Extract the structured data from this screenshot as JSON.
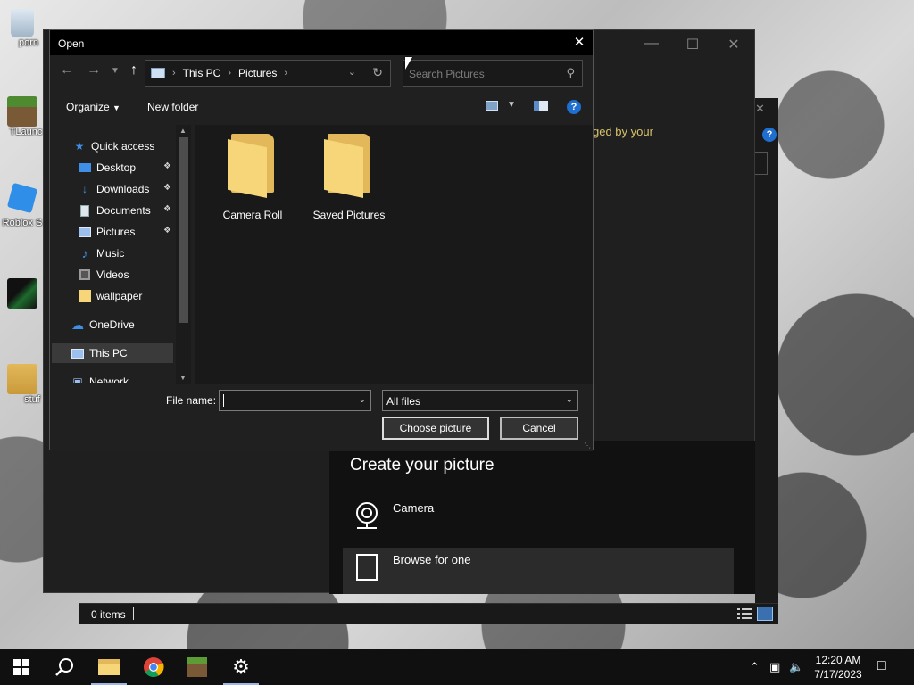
{
  "desktop": {
    "icons": [
      {
        "name": "recycle-bin-icon",
        "label": "porn"
      },
      {
        "name": "tlauncher-icon",
        "label": "TLaunc"
      },
      {
        "name": "roblox-icon",
        "label": "Roblox S"
      },
      {
        "name": "shortcut-icon",
        "label": ""
      },
      {
        "name": "folder-stuff-icon",
        "label": "stuf"
      }
    ]
  },
  "settings_window": {
    "notice": "ged by your",
    "panel_title": "Create your picture",
    "options": [
      {
        "label": "Camera"
      },
      {
        "label": "Browse for one"
      }
    ]
  },
  "explorer_status": {
    "items_count": "0 items"
  },
  "dialog": {
    "title": "Open",
    "close_glyph": "✕",
    "breadcrumb": [
      "This PC",
      "Pictures"
    ],
    "search_placeholder": "Search Pictures",
    "toolbar": {
      "organize": "Organize",
      "new_folder": "New folder",
      "help": "?"
    },
    "nav": [
      {
        "label": "Quick access",
        "icon": "star-icon",
        "pinned": false
      },
      {
        "label": "Desktop",
        "icon": "desktop-icon",
        "pinned": true
      },
      {
        "label": "Downloads",
        "icon": "download-icon",
        "pinned": true
      },
      {
        "label": "Documents",
        "icon": "documents-icon",
        "pinned": true
      },
      {
        "label": "Pictures",
        "icon": "pictures-icon",
        "pinned": true
      },
      {
        "label": "Music",
        "icon": "music-icon",
        "pinned": false
      },
      {
        "label": "Videos",
        "icon": "videos-icon",
        "pinned": false
      },
      {
        "label": "wallpaper",
        "icon": "folder-icon",
        "pinned": false
      },
      {
        "label": "OneDrive",
        "icon": "cloud-icon",
        "pinned": false
      },
      {
        "label": "This PC",
        "icon": "computer-icon",
        "pinned": false
      },
      {
        "label": "Network",
        "icon": "network-icon",
        "pinned": false
      }
    ],
    "files": [
      {
        "label": "Camera Roll"
      },
      {
        "label": "Saved Pictures"
      }
    ],
    "file_name_label": "File name:",
    "file_name_value": "",
    "filter_value": "All files",
    "choose_button": "Choose picture",
    "cancel_button": "Cancel"
  },
  "taskbar": {
    "time": "12:20 AM",
    "date": "7/17/2023"
  },
  "colors": {
    "accent_blue": "#1f6fd1",
    "folder_yellow": "#f7d67a",
    "dark_bg": "#202020",
    "notice_yellow": "#d9c36a"
  }
}
